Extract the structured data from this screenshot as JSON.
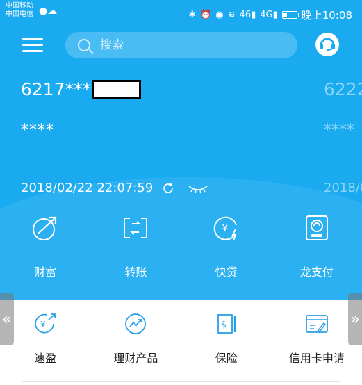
{
  "status_bar": {
    "carrier_1": "中国移动",
    "carrier_2": "中国电信",
    "left_icons": "●☁",
    "signal_1": "46",
    "signal_2": "4G",
    "time": "晚上10:08"
  },
  "toolbar": {
    "search_placeholder": "搜索"
  },
  "account": {
    "card_number_prefix": "6217***",
    "card_number_next": "6222",
    "balance_masked": "****",
    "balance_masked_next": "****",
    "updated_at": "2018/02/22 22:07:59",
    "updated_at_next": "2018/0"
  },
  "main_nav": [
    {
      "label": "财富",
      "icon": "wealth-icon"
    },
    {
      "label": "转账",
      "icon": "transfer-icon"
    },
    {
      "label": "快贷",
      "icon": "quick-loan-icon"
    },
    {
      "label": "龙支付",
      "icon": "long-pay-icon"
    }
  ],
  "quick_services": [
    {
      "label": "速盈",
      "icon": "suying-icon"
    },
    {
      "label": "理财产品",
      "icon": "wealth-product-icon"
    },
    {
      "label": "保险",
      "icon": "insurance-icon"
    },
    {
      "label": "信用卡申请",
      "icon": "credit-card-apply-icon"
    }
  ],
  "colors": {
    "primary": "#1aaaf0",
    "icon_blue": "#2a9fe6",
    "text_dark": "#222222"
  },
  "arrows": {
    "left": "«",
    "right": "»"
  }
}
